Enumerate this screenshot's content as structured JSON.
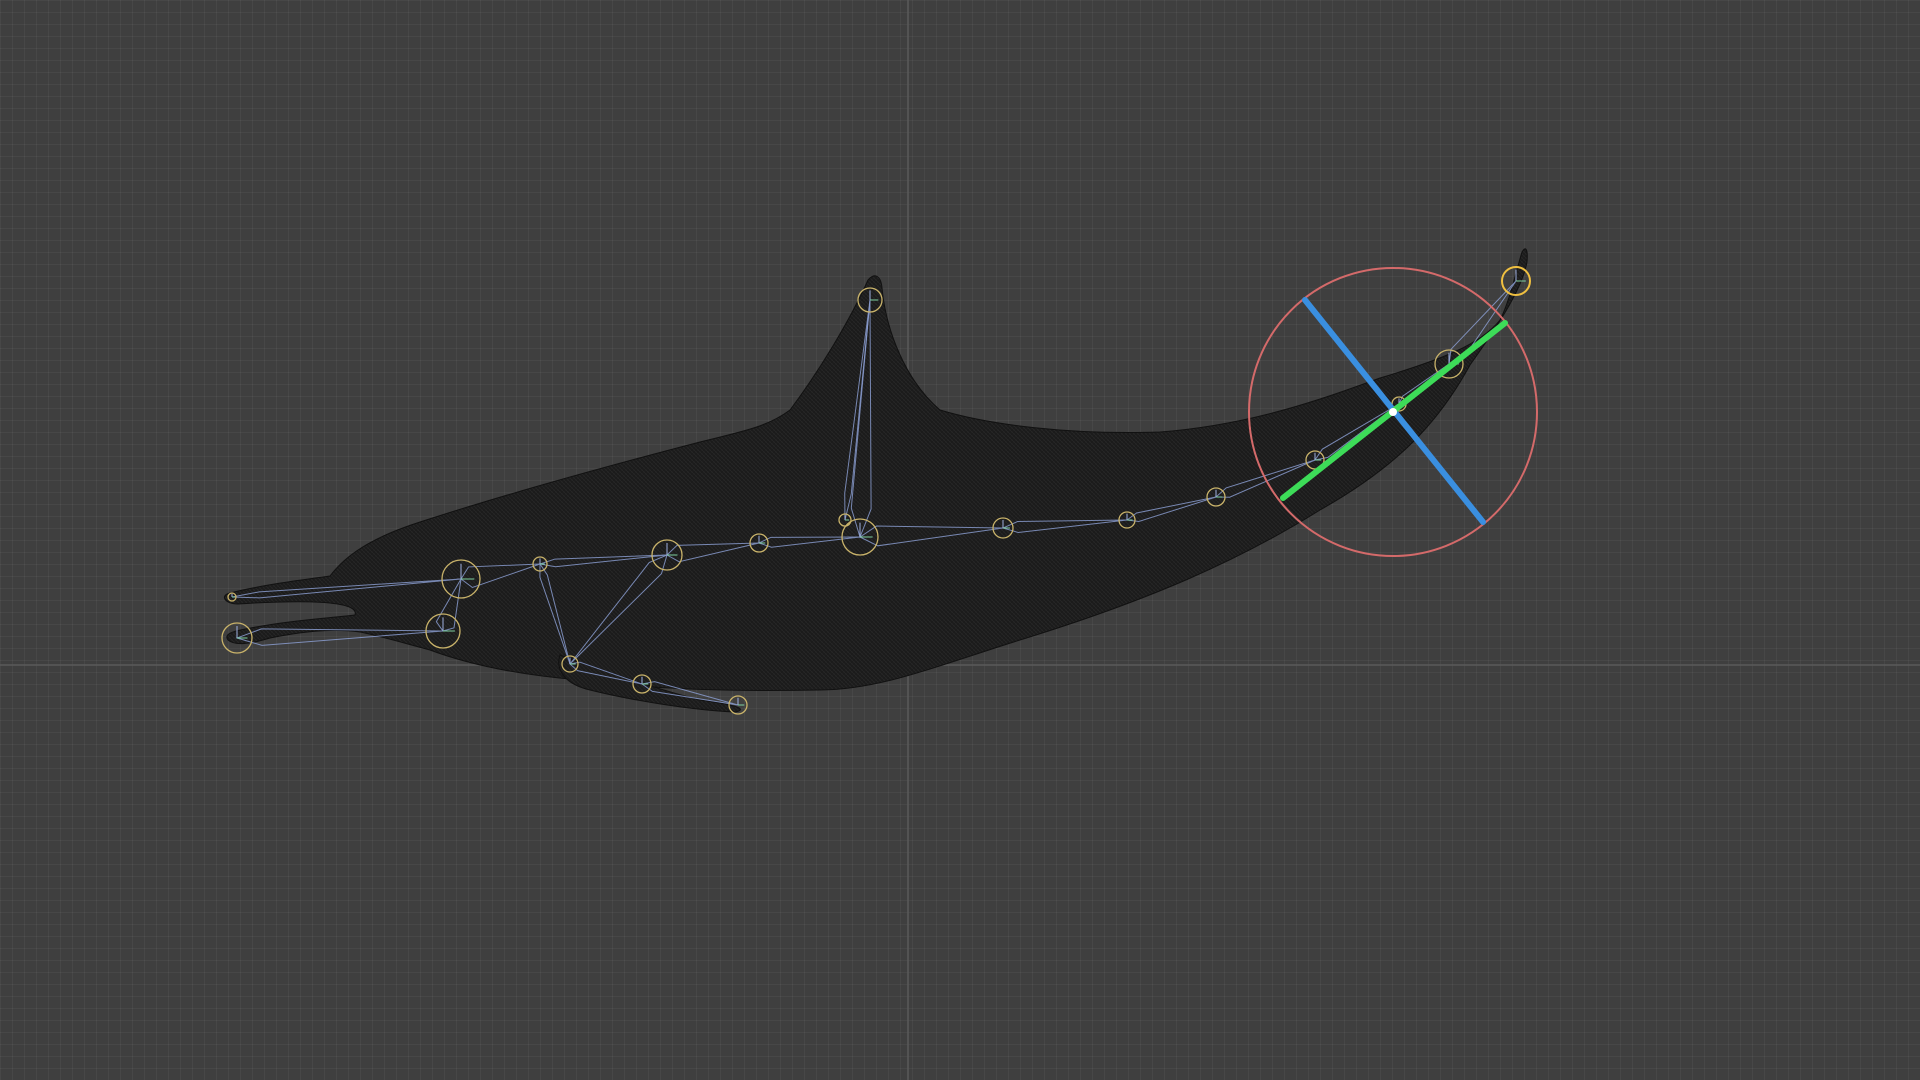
{
  "viewport": {
    "mode": "3d-viewport",
    "colors": {
      "background": "#3f3f3f",
      "axis": "#5a5a5a",
      "mesh": "#1b1b1b",
      "bone": "#8fa2d8",
      "joint_default": "#c9b36a",
      "joint_selected": "#f0c040",
      "rotation_gizmo": "#d46a6a",
      "gizmo_y_axis": "#3ddc58",
      "gizmo_z_axis": "#3a8fe0"
    }
  },
  "model": {
    "object": "dolphin-mesh",
    "display": "wireframe"
  },
  "rig": {
    "selected_joint": "tail-tip",
    "joints": [
      "jaw-upper-tip",
      "jaw-lower-tip",
      "head",
      "jaw-root",
      "neck",
      "chest",
      "flipper-root",
      "flipper-mid",
      "flipper-tip",
      "spine-1",
      "spine-2",
      "dorsal-root",
      "dorsal-tip",
      "spine-3",
      "spine-4",
      "spine-5",
      "spine-6",
      "tail-1",
      "tail-2",
      "tail-tip"
    ]
  },
  "gizmo": {
    "type": "rotate",
    "active_joint": "tail-2"
  }
}
